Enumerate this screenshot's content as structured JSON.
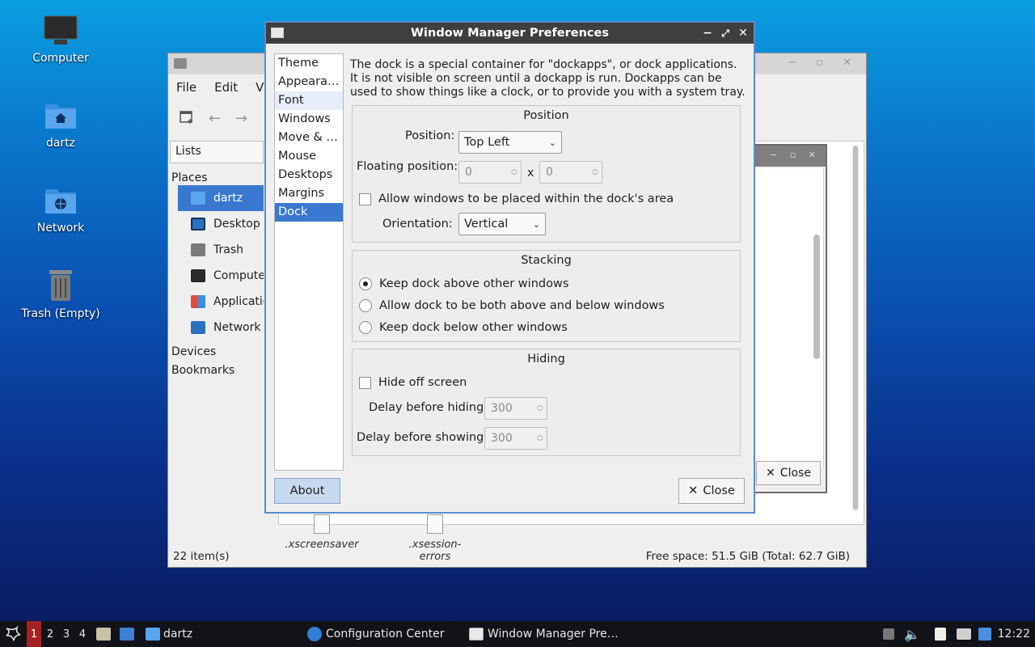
{
  "desktop": {
    "icons": [
      {
        "name": "computer",
        "label": "Computer"
      },
      {
        "name": "home",
        "label": "dartz"
      },
      {
        "name": "network",
        "label": "Network"
      },
      {
        "name": "trash",
        "label": "Trash (Empty)"
      }
    ]
  },
  "file_manager": {
    "menu": [
      "File",
      "Edit",
      "Vi"
    ],
    "lists_label": "Lists",
    "places_label": "Places",
    "places": [
      {
        "label": "dartz",
        "icon": "home-folder-icon",
        "selected": true
      },
      {
        "label": "Desktop",
        "icon": "desktop-icon"
      },
      {
        "label": "Trash",
        "icon": "trash-icon"
      },
      {
        "label": "Computer",
        "icon": "computer-icon"
      },
      {
        "label": "Applicatio",
        "icon": "applications-icon"
      },
      {
        "label": "Network",
        "icon": "network-icon"
      }
    ],
    "devices_label": "Devices",
    "bookmarks_label": "Bookmarks",
    "files": [
      ".xscreensaver",
      ".xsession-errors"
    ],
    "status_items": "22 item(s)",
    "status_space": "Free space: 51.5 GiB (Total: 62.7 GiB)"
  },
  "behind_dialog": {
    "close_label": "Close"
  },
  "wm_prefs": {
    "title": "Window Manager Preferences",
    "categories": [
      "Theme",
      "Appeara…",
      "Font",
      "Windows",
      "Move & …",
      "Mouse",
      "Desktops",
      "Margins",
      "Dock"
    ],
    "selected_category": "Dock",
    "description": "The dock is a special container for \"dockapps\", or dock applications.  It is not visible on screen until a dockapp is run.  Dockapps can be used to show things like a clock, or to provide you with a system tray.",
    "position_group": {
      "title": "Position",
      "position_label": "Position:",
      "position_value": "Top Left",
      "floating_label": "Floating position:",
      "floating_x": "0",
      "floating_sep": "x",
      "floating_y": "0",
      "allow_label": "Allow windows to be placed within the dock's area",
      "allow_checked": false,
      "orientation_label": "Orientation:",
      "orientation_value": "Vertical"
    },
    "stacking_group": {
      "title": "Stacking",
      "options": [
        {
          "label": "Keep dock above other windows",
          "selected": true
        },
        {
          "label": "Allow dock to be both above and below windows",
          "selected": false
        },
        {
          "label": "Keep dock below other windows",
          "selected": false
        }
      ]
    },
    "hiding_group": {
      "title": "Hiding",
      "hide_label": "Hide off screen",
      "hide_checked": false,
      "delay_hiding_label": "Delay before hiding:",
      "delay_hiding_value": "300",
      "delay_showing_label": "Delay before showing:",
      "delay_showing_value": "300"
    },
    "about_label": "About",
    "close_label": "Close"
  },
  "taskbar": {
    "workspaces": [
      "1",
      "2",
      "3",
      "4"
    ],
    "active_workspace": "1",
    "tasks": [
      "dartz",
      "Configuration Center",
      "Window Manager Pre…"
    ],
    "clock": "12:22"
  },
  "colors": {
    "selection": "#3a78d0",
    "title_bar": "#3f3f3f",
    "taskbar": "#111319",
    "active_workspace": "#a52222"
  }
}
